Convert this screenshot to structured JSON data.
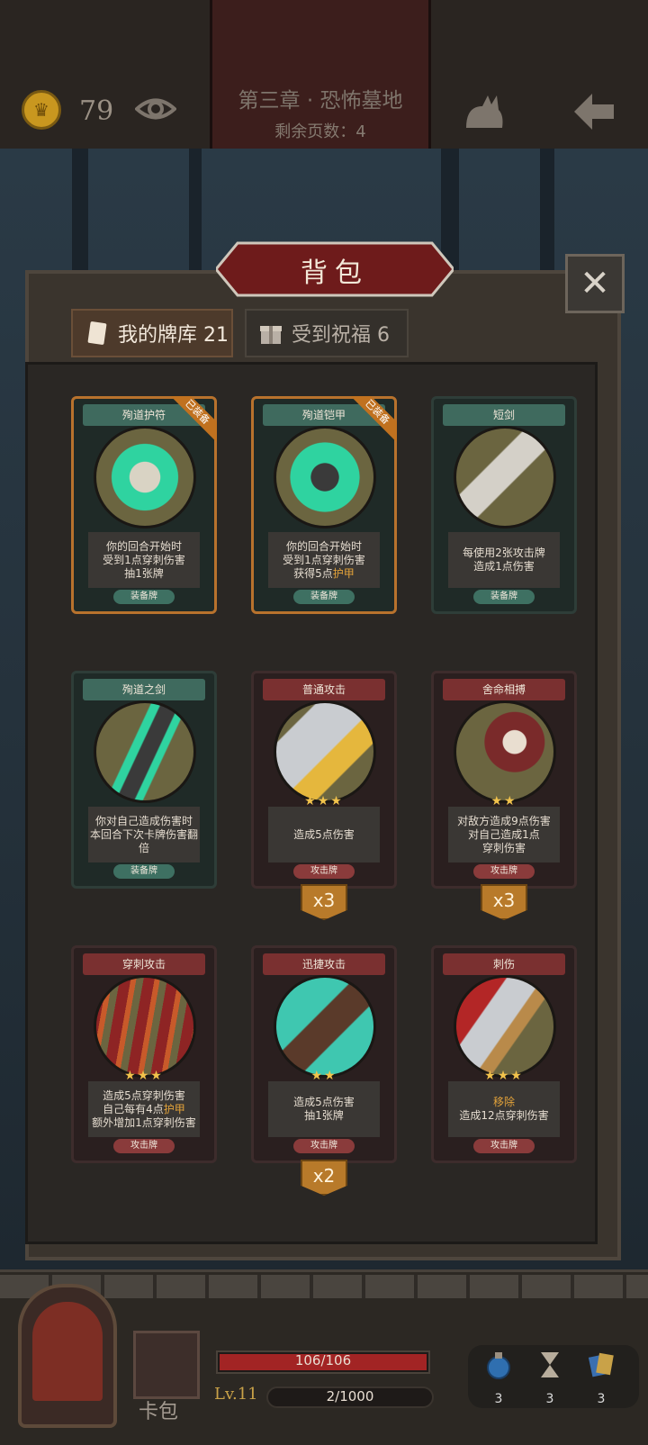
{
  "header": {
    "gold": "79",
    "chapter_title": "第三章 · 恐怖墓地",
    "pages_left": "剩余页数：4"
  },
  "dialog": {
    "title": "背包",
    "tabs": [
      {
        "label": "我的牌库 21",
        "active": true
      },
      {
        "label": "受到祝福 6",
        "active": false
      }
    ]
  },
  "cards": [
    {
      "name": "殉道护符",
      "kind": "equip",
      "equipped_label": "已装备",
      "desc": "你的回合开始时\n受到1点穿刺伤害\n抽1张牌",
      "type_label": "装备牌",
      "stars": "",
      "count": ""
    },
    {
      "name": "殉道铠甲",
      "kind": "equip",
      "equipped_label": "已装备",
      "desc_pre": "你的回合开始时\n受到1点穿刺伤害\n获得5点",
      "desc_hl": "护甲",
      "type_label": "装备牌",
      "stars": "",
      "count": ""
    },
    {
      "name": "短剑",
      "kind": "equip",
      "equipped_label": "",
      "desc": "每使用2张攻击牌\n造成1点伤害",
      "type_label": "装备牌",
      "stars": "",
      "count": ""
    },
    {
      "name": "殉道之剑",
      "kind": "equip",
      "equipped_label": "",
      "desc": "你对自己造成伤害时\n本回合下次卡牌伤害翻倍",
      "type_label": "装备牌",
      "stars": "",
      "count": ""
    },
    {
      "name": "普通攻击",
      "kind": "attack",
      "equipped_label": "",
      "desc": "造成5点伤害",
      "type_label": "攻击牌",
      "stars": "★★★",
      "count": "x3"
    },
    {
      "name": "舍命相搏",
      "kind": "attack",
      "equipped_label": "",
      "desc": "对敌方造成9点伤害\n对自己造成1点\n穿刺伤害",
      "type_label": "攻击牌",
      "stars": "★★",
      "count": "x3"
    },
    {
      "name": "穿刺攻击",
      "kind": "attack",
      "equipped_label": "",
      "desc_pre": "造成5点穿刺伤害\n自己每有4点",
      "desc_hl": "护甲",
      "desc_post": "\n额外增加1点穿刺伤害",
      "type_label": "攻击牌",
      "stars": "★★★",
      "count": ""
    },
    {
      "name": "迅捷攻击",
      "kind": "attack",
      "equipped_label": "",
      "desc": "造成5点伤害\n抽1张牌",
      "type_label": "攻击牌",
      "stars": "★★",
      "count": "x2"
    },
    {
      "name": "刺伤",
      "kind": "attack",
      "equipped_label": "",
      "desc_hl_pre": "移除",
      "desc": "\n造成12点穿刺伤害",
      "type_label": "攻击牌",
      "stars": "★★★",
      "count": ""
    }
  ],
  "player": {
    "hp": "106/106",
    "hp_fraction": 1.0,
    "level": "Lv.11",
    "xp": "2/1000",
    "deck_label": "卡包",
    "resources": [
      "3",
      "3",
      "3"
    ]
  },
  "colors": {
    "equip_header": "#3f6a5e",
    "attack_header": "#7a3030",
    "equipped_ribbon": "#c0711f",
    "highlight": "#e2a23a"
  }
}
